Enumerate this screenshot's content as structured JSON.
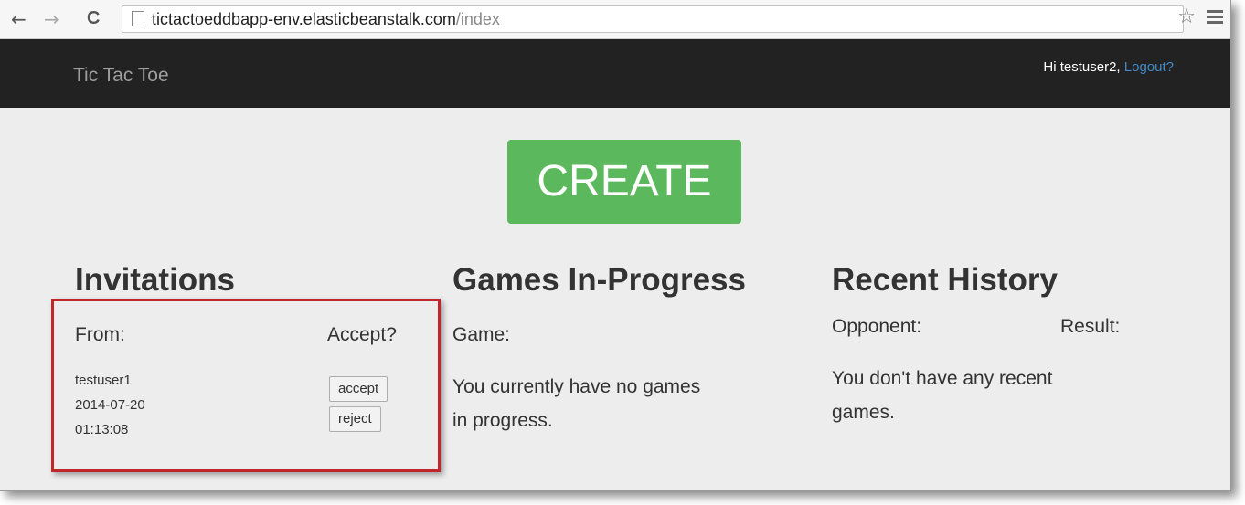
{
  "browser": {
    "url_domain": "tictactoeddbapp-env.elasticbeanstalk.com",
    "url_path": "/index",
    "back_icon": "←",
    "forward_icon": "→",
    "reload_icon": "C",
    "star_icon": "☆"
  },
  "navbar": {
    "brand": "Tic Tac Toe",
    "greeting": "Hi testuser2, ",
    "logout": "Logout?"
  },
  "create_label": "CREATE",
  "invitations": {
    "title": "Invitations",
    "from_header": "From:",
    "accept_header": "Accept?",
    "items": [
      {
        "user": "testuser1",
        "date": "2014-07-20",
        "time": "01:13:08",
        "accept": "accept",
        "reject": "reject"
      }
    ]
  },
  "games": {
    "title": "Games In-Progress",
    "header": "Game:",
    "empty_line1": "You currently have no games",
    "empty_line2": "in progress."
  },
  "history": {
    "title": "Recent History",
    "opponent_header": "Opponent:",
    "result_header": "Result:",
    "empty_line1": "You don't have any recent",
    "empty_line2": "games."
  },
  "colors": {
    "navbar_bg": "#222222",
    "create_bg": "#5cb85c",
    "link": "#428bca",
    "highlight_border": "#c0272d",
    "page_bg": "#ededed"
  }
}
